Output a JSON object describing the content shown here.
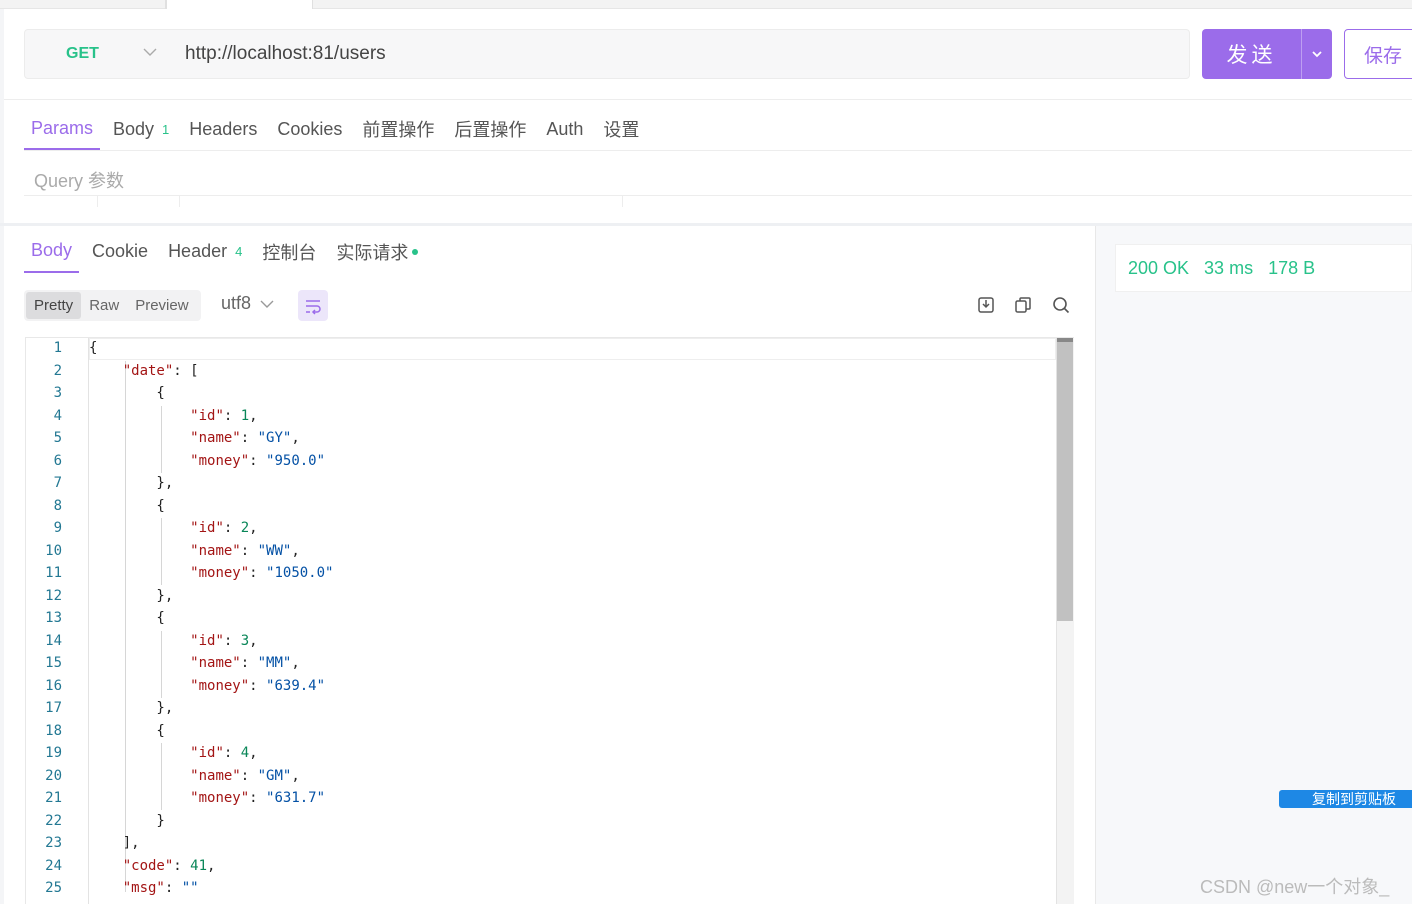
{
  "request": {
    "method": "GET",
    "url": "http://localhost:81/users",
    "send_label": "发送",
    "save_label": "保存"
  },
  "request_tabs": [
    {
      "label": "Params",
      "active": true
    },
    {
      "label": "Body",
      "badge": "1"
    },
    {
      "label": "Headers"
    },
    {
      "label": "Cookies"
    },
    {
      "label": "前置操作"
    },
    {
      "label": "后置操作"
    },
    {
      "label": "Auth"
    },
    {
      "label": "设置"
    }
  ],
  "query_label": "Query 参数",
  "response_tabs": [
    {
      "label": "Body",
      "active": true
    },
    {
      "label": "Cookie"
    },
    {
      "label": "Header",
      "badge": "4"
    },
    {
      "label": "控制台"
    },
    {
      "label": "实际请求",
      "dot": true
    }
  ],
  "view_modes": [
    "Pretty",
    "Raw",
    "Preview"
  ],
  "active_view_mode": "Pretty",
  "encoding": "utf8",
  "toolbar_icons": [
    "wrap-icon",
    "download-icon",
    "copy-icon",
    "search-icon"
  ],
  "response_status": {
    "status": "200 OK",
    "time": "33 ms",
    "size": "178 B"
  },
  "copy_button": "复制到剪贴板",
  "watermark": "CSDN @new一个对象_",
  "colors": {
    "accent": "#9b6cea",
    "method_green": "#28c28a",
    "json_key": "#a31515",
    "json_string": "#0451a5",
    "json_number": "#098658",
    "line_number": "#237893"
  },
  "code": {
    "line_numbers": [
      "1",
      "2",
      "3",
      "4",
      "5",
      "6",
      "7",
      "8",
      "9",
      "10",
      "11",
      "12",
      "13",
      "14",
      "15",
      "16",
      "17",
      "18",
      "19",
      "20",
      "21",
      "22",
      "23",
      "24",
      "25"
    ],
    "lines": [
      [
        [
          "p",
          "{"
        ]
      ],
      [
        [
          "p",
          "    "
        ],
        [
          "k",
          "\"date\""
        ],
        [
          "p",
          ": ["
        ]
      ],
      [
        [
          "p",
          "        {"
        ]
      ],
      [
        [
          "p",
          "            "
        ],
        [
          "k",
          "\"id\""
        ],
        [
          "p",
          ": "
        ],
        [
          "n",
          "1"
        ],
        [
          "p",
          ","
        ]
      ],
      [
        [
          "p",
          "            "
        ],
        [
          "k",
          "\"name\""
        ],
        [
          "p",
          ": "
        ],
        [
          "s",
          "\"GY\""
        ],
        [
          "p",
          ","
        ]
      ],
      [
        [
          "p",
          "            "
        ],
        [
          "k",
          "\"money\""
        ],
        [
          "p",
          ": "
        ],
        [
          "s",
          "\"950.0\""
        ]
      ],
      [
        [
          "p",
          "        },"
        ]
      ],
      [
        [
          "p",
          "        {"
        ]
      ],
      [
        [
          "p",
          "            "
        ],
        [
          "k",
          "\"id\""
        ],
        [
          "p",
          ": "
        ],
        [
          "n",
          "2"
        ],
        [
          "p",
          ","
        ]
      ],
      [
        [
          "p",
          "            "
        ],
        [
          "k",
          "\"name\""
        ],
        [
          "p",
          ": "
        ],
        [
          "s",
          "\"WW\""
        ],
        [
          "p",
          ","
        ]
      ],
      [
        [
          "p",
          "            "
        ],
        [
          "k",
          "\"money\""
        ],
        [
          "p",
          ": "
        ],
        [
          "s",
          "\"1050.0\""
        ]
      ],
      [
        [
          "p",
          "        },"
        ]
      ],
      [
        [
          "p",
          "        {"
        ]
      ],
      [
        [
          "p",
          "            "
        ],
        [
          "k",
          "\"id\""
        ],
        [
          "p",
          ": "
        ],
        [
          "n",
          "3"
        ],
        [
          "p",
          ","
        ]
      ],
      [
        [
          "p",
          "            "
        ],
        [
          "k",
          "\"name\""
        ],
        [
          "p",
          ": "
        ],
        [
          "s",
          "\"MM\""
        ],
        [
          "p",
          ","
        ]
      ],
      [
        [
          "p",
          "            "
        ],
        [
          "k",
          "\"money\""
        ],
        [
          "p",
          ": "
        ],
        [
          "s",
          "\"639.4\""
        ]
      ],
      [
        [
          "p",
          "        },"
        ]
      ],
      [
        [
          "p",
          "        {"
        ]
      ],
      [
        [
          "p",
          "            "
        ],
        [
          "k",
          "\"id\""
        ],
        [
          "p",
          ": "
        ],
        [
          "n",
          "4"
        ],
        [
          "p",
          ","
        ]
      ],
      [
        [
          "p",
          "            "
        ],
        [
          "k",
          "\"name\""
        ],
        [
          "p",
          ": "
        ],
        [
          "s",
          "\"GM\""
        ],
        [
          "p",
          ","
        ]
      ],
      [
        [
          "p",
          "            "
        ],
        [
          "k",
          "\"money\""
        ],
        [
          "p",
          ": "
        ],
        [
          "s",
          "\"631.7\""
        ]
      ],
      [
        [
          "p",
          "        }"
        ]
      ],
      [
        [
          "p",
          "    ],"
        ]
      ],
      [
        [
          "p",
          "    "
        ],
        [
          "k",
          "\"code\""
        ],
        [
          "p",
          ": "
        ],
        [
          "n",
          "41"
        ],
        [
          "p",
          ","
        ]
      ],
      [
        [
          "p",
          "    "
        ],
        [
          "k",
          "\"msg\""
        ],
        [
          "p",
          ": "
        ],
        [
          "s",
          "\"\""
        ]
      ]
    ]
  }
}
